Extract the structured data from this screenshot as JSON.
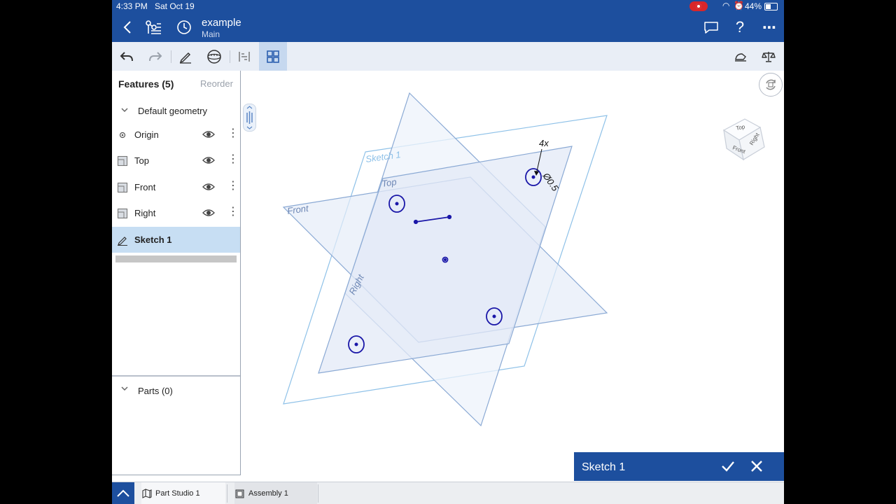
{
  "status": {
    "time": "4:33 PM",
    "date": "Sat Oct 19",
    "battery": "44%"
  },
  "document": {
    "title": "example",
    "branch": "Main"
  },
  "features": {
    "heading": "Features (5)",
    "reorder": "Reorder",
    "group": "Default geometry",
    "items": [
      {
        "label": "Origin",
        "icon": "origin-icon"
      },
      {
        "label": "Top",
        "icon": "plane-icon"
      },
      {
        "label": "Front",
        "icon": "plane-icon"
      },
      {
        "label": "Right",
        "icon": "plane-icon"
      },
      {
        "label": "Sketch 1",
        "icon": "sketch-icon",
        "selected": true
      }
    ]
  },
  "parts": {
    "label": "Parts (0)"
  },
  "viewport": {
    "plane_labels": {
      "sketch": "Sketch 1",
      "top": "Top",
      "front": "Front",
      "right": "Right"
    },
    "dimension": {
      "count": "4x",
      "value": "Ø0.5"
    },
    "view_cube": {
      "top": "Top",
      "front": "Front",
      "right": "Right"
    }
  },
  "sketch_dialog": {
    "title": "Sketch 1"
  },
  "tabs": [
    {
      "label": "Part Studio 1",
      "active": true
    },
    {
      "label": "Assembly 1",
      "active": false
    }
  ],
  "colors": {
    "brand": "#1d4f9e",
    "selection": "#c7def3",
    "plane_stroke": "#7aa6d6",
    "sketch_entity": "#1a17a8"
  }
}
